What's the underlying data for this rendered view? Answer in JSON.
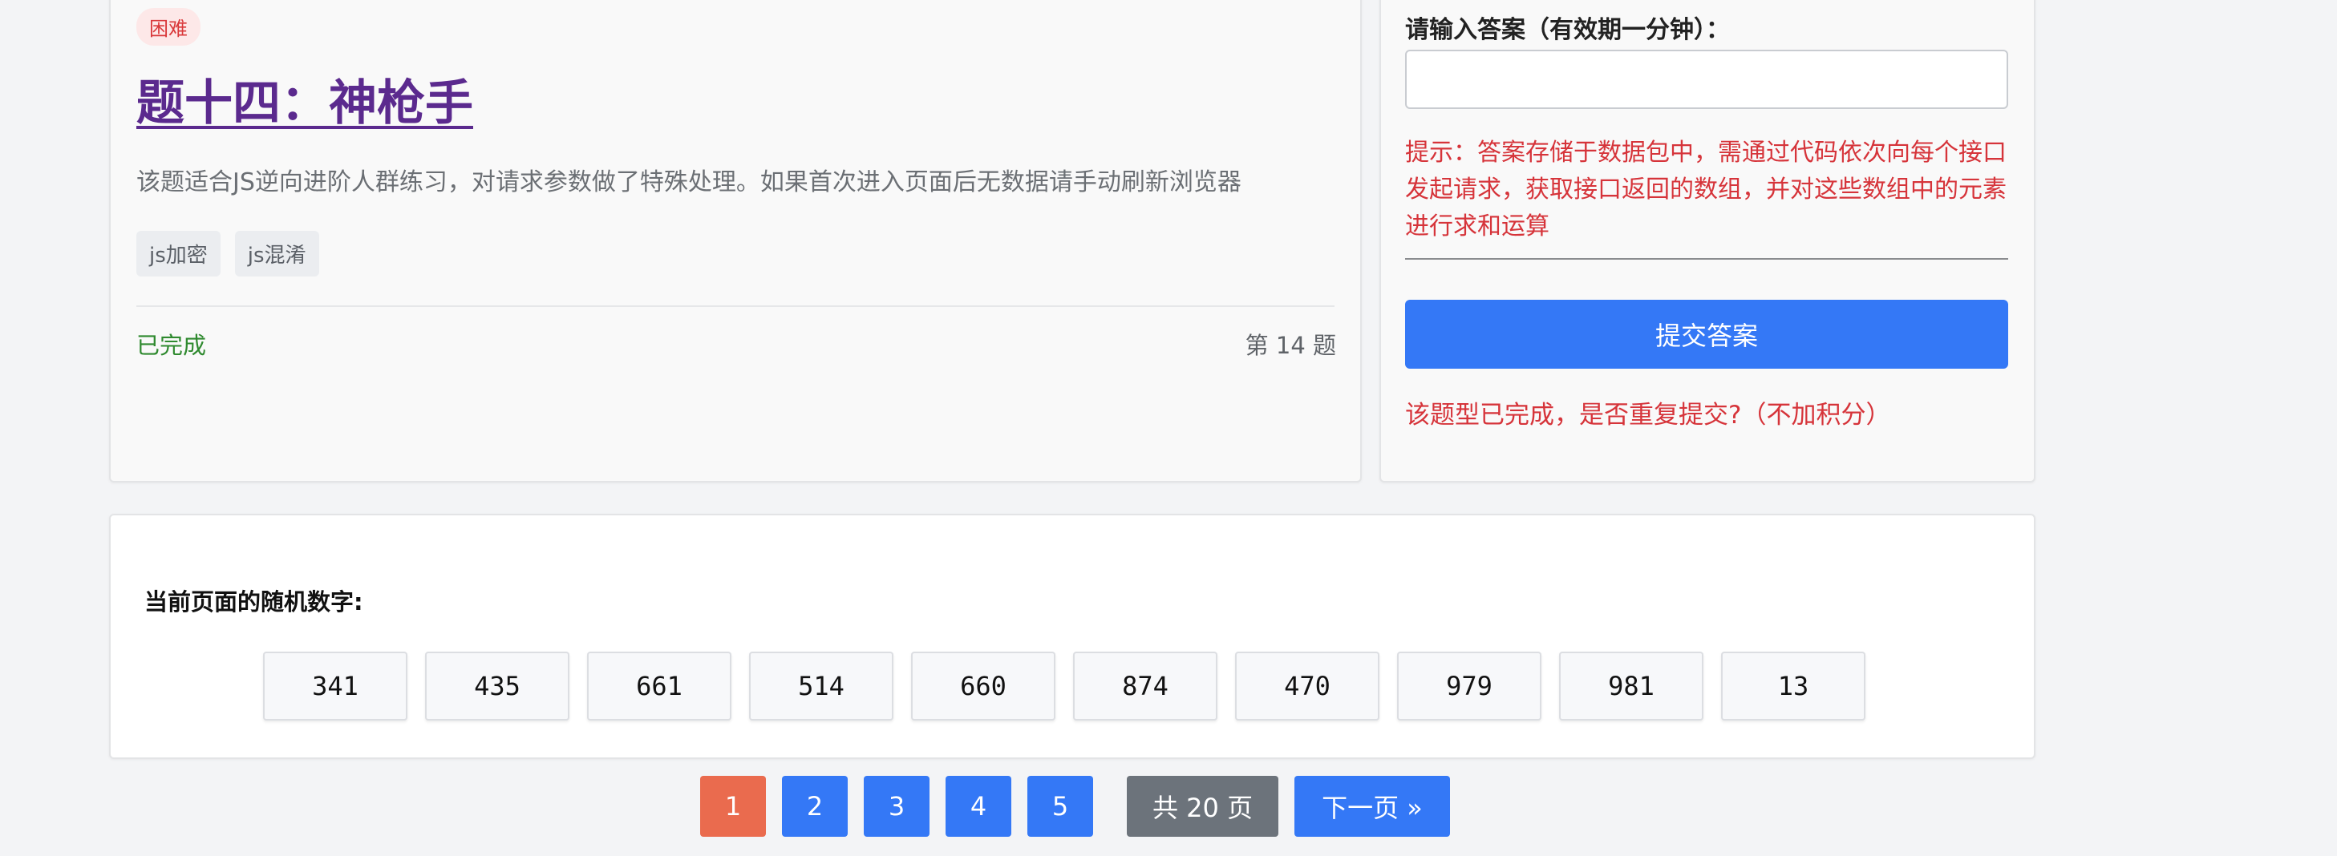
{
  "problem": {
    "difficulty": "困难",
    "title": "题十四：神枪手",
    "description": "该题适合JS逆向进阶人群练习，对请求参数做了特殊处理。如果首次进入页面后无数据请手动刷新浏览器",
    "tags": [
      "js加密",
      "js混淆"
    ],
    "status": "已完成",
    "number_label": "第 14 题"
  },
  "answer": {
    "label": "请输入答案（有效期一分钟）：",
    "input_value": "",
    "hint": "提示：答案存储于数据包中，需通过代码依次向每个接口发起请求，获取接口返回的数组，并对这些数组中的元素进行求和运算",
    "submit_label": "提交答案",
    "resubmit_text": "该题型已完成，是否重复提交?（不加积分）"
  },
  "random_numbers": {
    "label": "当前页面的随机数字:",
    "values": [
      "341",
      "435",
      "661",
      "514",
      "660",
      "874",
      "470",
      "979",
      "981",
      "13"
    ]
  },
  "pagination": {
    "pages": [
      "1",
      "2",
      "3",
      "4",
      "5"
    ],
    "current": "1",
    "total_label": "共 20 页",
    "next_label": "下一页 »"
  },
  "colors": {
    "primary": "#3478f6",
    "active_page": "#ea6b4e",
    "danger": "#d6343a",
    "success": "#2f8a2f",
    "title": "#5b2a8e"
  }
}
